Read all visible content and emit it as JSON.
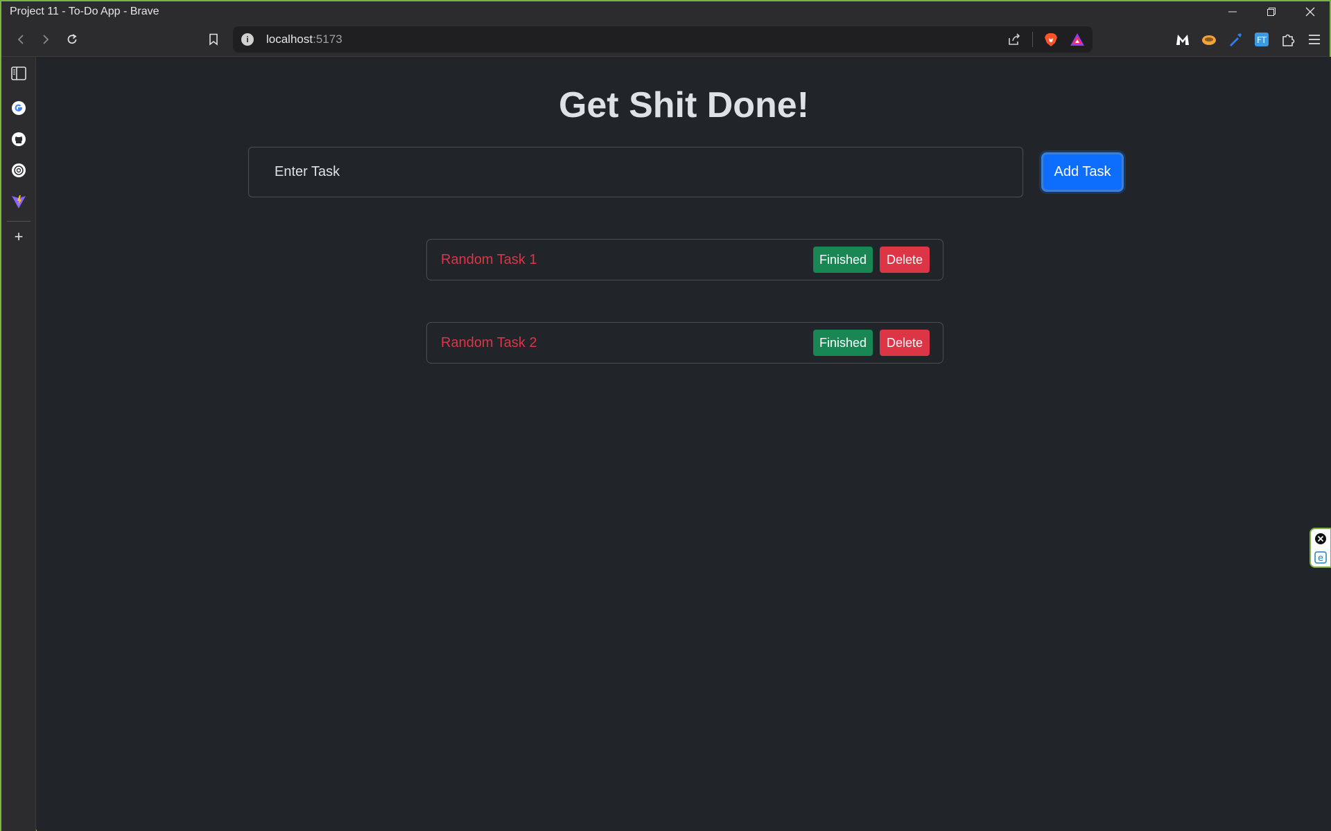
{
  "window": {
    "title": "Project 11 - To-Do App - Brave",
    "controls": [
      "minimize",
      "restore",
      "close"
    ]
  },
  "toolbar": {
    "address_host": "localhost",
    "address_port": ":5173"
  },
  "sidebar": {
    "items": [
      "sidebar-panel-icon",
      "google-icon",
      "github-icon",
      "openai-icon",
      "vite-icon"
    ],
    "add_label": "+"
  },
  "app": {
    "heading": "Get Shit Done!",
    "input_placeholder": "Enter Task",
    "input_value": "",
    "add_button_label": "Add Task",
    "tasks": [
      {
        "text": "Random Task 1",
        "finished_label": "Finished",
        "delete_label": "Delete"
      },
      {
        "text": "Random Task 2",
        "finished_label": "Finished",
        "delete_label": "Delete"
      }
    ]
  },
  "colors": {
    "page_bg": "#212529",
    "primary": "#0d6efd",
    "success": "#198754",
    "danger": "#dc3545",
    "window_border": "#7cb342"
  }
}
